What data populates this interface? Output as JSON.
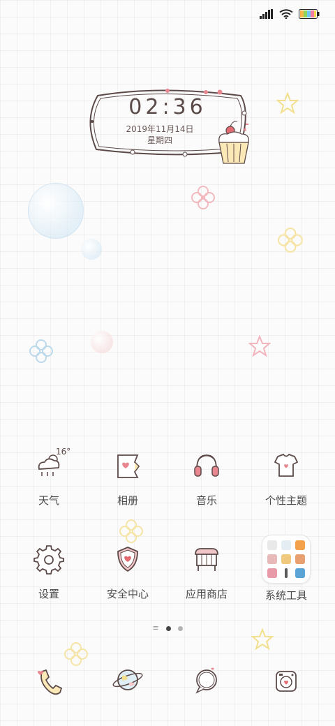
{
  "status_bar": {
    "signal_icon": "signal-bars-icon",
    "wifi_icon": "wifi-icon",
    "battery_icon": "battery-icon"
  },
  "clock": {
    "time": "02:36",
    "date": "2019年11月14日",
    "weekday": "星期四"
  },
  "weather": {
    "temperature": "16°"
  },
  "apps": [
    {
      "label": "天气",
      "icon": "weather-cloud-icon"
    },
    {
      "label": "相册",
      "icon": "album-icon"
    },
    {
      "label": "音乐",
      "icon": "headphones-icon"
    },
    {
      "label": "个性主题",
      "icon": "tshirt-icon"
    },
    {
      "label": "设置",
      "icon": "gear-icon"
    },
    {
      "label": "安全中心",
      "icon": "shield-heart-icon"
    },
    {
      "label": "应用商店",
      "icon": "shop-icon"
    },
    {
      "label": "系统工具",
      "icon": "folder-icon"
    }
  ],
  "page_indicator": {
    "pages": 2,
    "current": 1
  },
  "dock": [
    {
      "icon": "phone-icon"
    },
    {
      "icon": "browser-planet-icon"
    },
    {
      "icon": "messages-bubble-icon"
    },
    {
      "icon": "camera-icon"
    }
  ],
  "colors": {
    "accent_pink": "#e8878f",
    "outline_brown": "#5c4a49",
    "background": "#fbfbfb"
  }
}
